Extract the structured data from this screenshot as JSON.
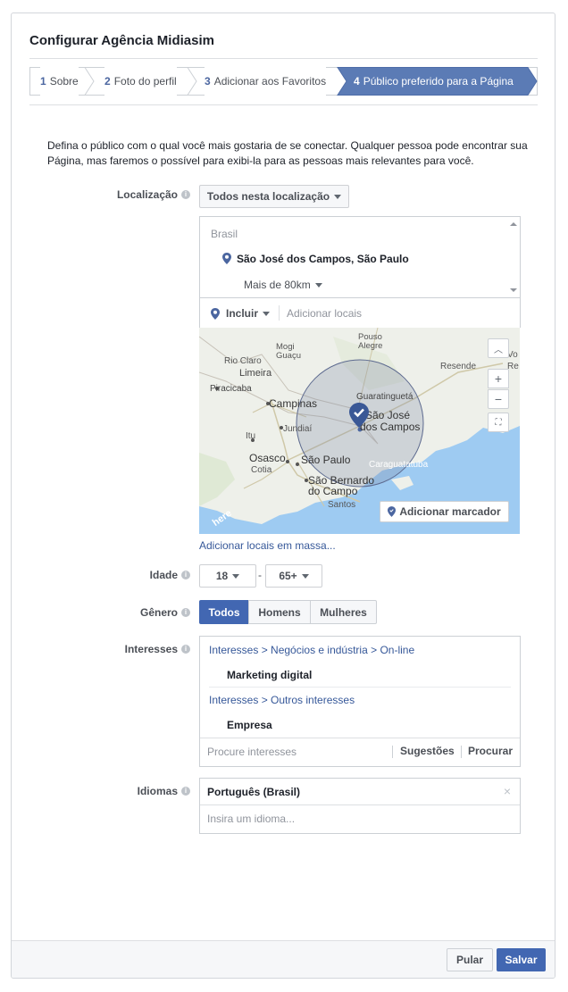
{
  "title": "Configurar Agência Midiasim",
  "steps": [
    {
      "num": "1",
      "label": "Sobre"
    },
    {
      "num": "2",
      "label": "Foto do perfil"
    },
    {
      "num": "3",
      "label": "Adicionar aos Favoritos"
    },
    {
      "num": "4",
      "label": "Público preferido para a Página"
    }
  ],
  "intro": "Defina o público com o qual você mais gostaria de se conectar. Qualquer pessoa pode encontrar sua Página, mas faremos o possível para exibi-la para as pessoas mais relevantes para você.",
  "location": {
    "label": "Localização",
    "dropdown": "Todos nesta localização",
    "country": "Brasil",
    "city": "São José dos Campos, São Paulo",
    "radius": "Mais de 80km",
    "include": "Incluir",
    "add_placeholder": "Adicionar locais",
    "add_marker": "Adicionar marcador",
    "bulk_link": "Adicionar locais em massa...",
    "map_labels": {
      "mogi": "Mogi Guaçu",
      "pouso": "Pouso Alegre",
      "rioclaro": "Rio Claro",
      "limeira": "Limeira",
      "piracicaba": "Piracicaba",
      "resende": "Resende",
      "volta": "Vo Re",
      "guaratingueta": "Guaratinguetá",
      "campinas": "Campinas",
      "sjc": "São José dos Campos",
      "jundiai": "Jundiaí",
      "itu": "Itu",
      "osasco": "Osasco",
      "saopaulo": "São Paulo",
      "cotia": "Cotia",
      "caragua": "Caraguatatuba",
      "sbc": "São Bernardo do Campo",
      "santos": "Santos",
      "here": "here"
    }
  },
  "age": {
    "label": "Idade",
    "min": "18",
    "sep": "-",
    "max": "65+"
  },
  "gender": {
    "label": "Gênero",
    "options": [
      "Todos",
      "Homens",
      "Mulheres"
    ]
  },
  "interests": {
    "label": "Interesses",
    "groups": [
      {
        "path": "Interesses > Negócios e indústria > On-line",
        "item": "Marketing digital"
      },
      {
        "path": "Interesses > Outros interesses",
        "item": "Empresa"
      }
    ],
    "placeholder": "Procure interesses",
    "suggestions": "Sugestões",
    "browse": "Procurar"
  },
  "languages": {
    "label": "Idiomas",
    "selected": "Português (Brasil)",
    "placeholder": "Insira um idioma..."
  },
  "footer": {
    "skip": "Pular",
    "save": "Salvar"
  },
  "colors": {
    "accent": "#4267b2",
    "active_step": "#5b7bb5",
    "water": "#9ecbf2"
  },
  "icons": {
    "info": "info-icon",
    "pin": "map-pin-icon",
    "close": "close-icon"
  }
}
